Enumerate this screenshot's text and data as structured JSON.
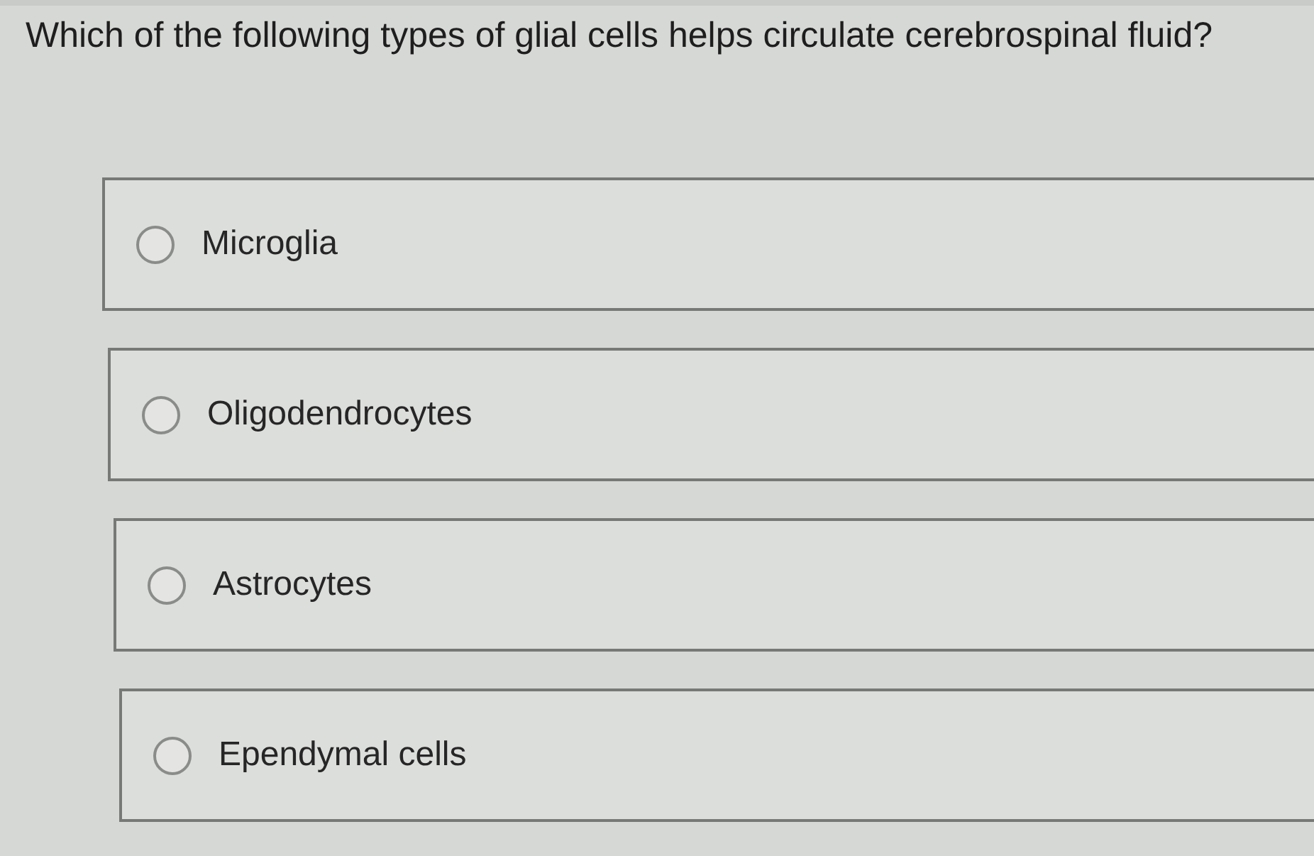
{
  "question": {
    "text": "Which of the following types of glial cells helps circulate cerebrospinal fluid?"
  },
  "options": [
    {
      "label": "Microglia",
      "selected": false
    },
    {
      "label": "Oligodendrocytes",
      "selected": false
    },
    {
      "label": "Astrocytes",
      "selected": false
    },
    {
      "label": "Ependymal cells",
      "selected": false
    }
  ]
}
